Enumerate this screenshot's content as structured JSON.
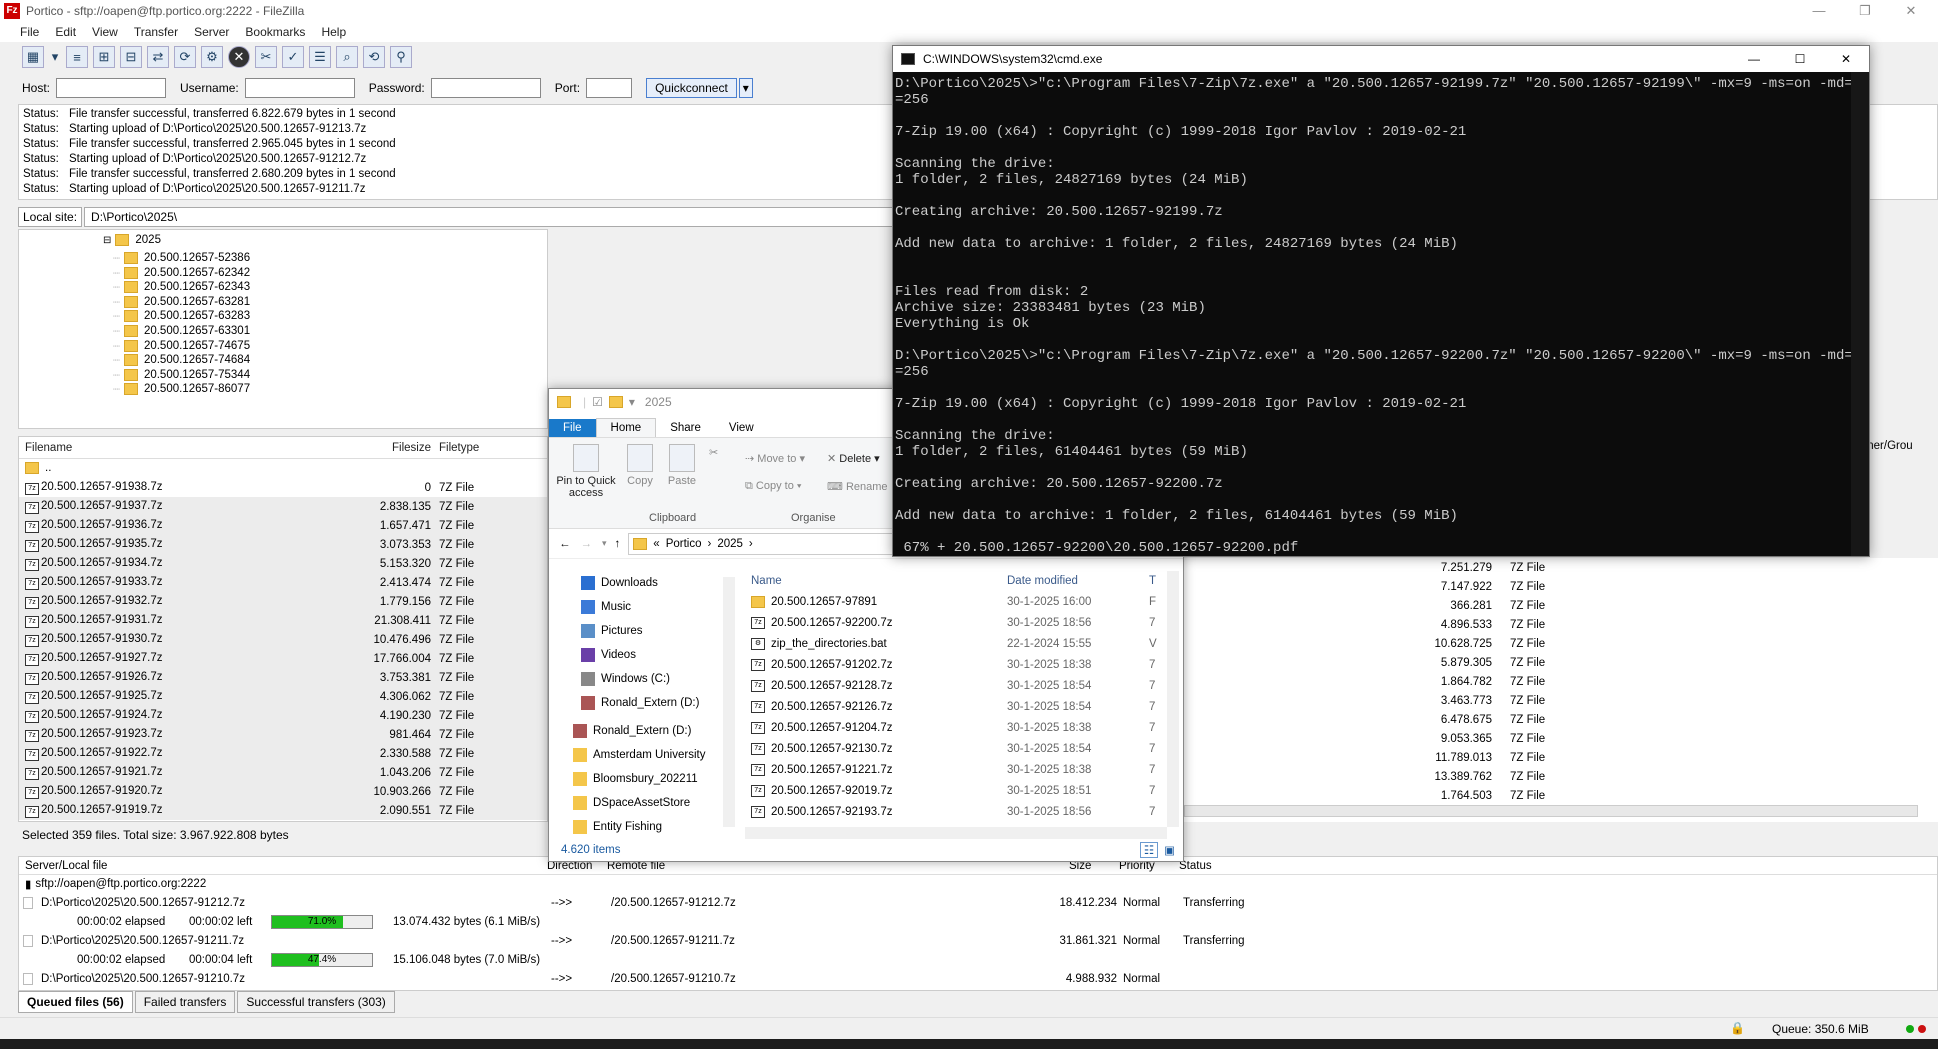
{
  "filezilla": {
    "title": "Portico - sftp://oapen@ftp.portico.org:2222 - FileZilla",
    "menu": [
      "File",
      "Edit",
      "View",
      "Transfer",
      "Server",
      "Bookmarks",
      "Help"
    ],
    "quickconnect": {
      "host_label": "Host:",
      "username_label": "Username:",
      "password_label": "Password:",
      "port_label": "Port:",
      "button": "Quickconnect"
    },
    "log": [
      {
        "label": "Status:",
        "text": "File transfer successful, transferred 6.822.679 bytes in 1 second"
      },
      {
        "label": "Status:",
        "text": "Starting upload of D:\\Portico\\2025\\20.500.12657-91213.7z"
      },
      {
        "label": "Status:",
        "text": "File transfer successful, transferred 2.965.045 bytes in 1 second"
      },
      {
        "label": "Status:",
        "text": "Starting upload of D:\\Portico\\2025\\20.500.12657-91212.7z"
      },
      {
        "label": "Status:",
        "text": "File transfer successful, transferred 2.680.209 bytes in 1 second"
      },
      {
        "label": "Status:",
        "text": "Starting upload of D:\\Portico\\2025\\20.500.12657-91211.7z"
      }
    ],
    "local_site_label": "Local site:",
    "local_site_path": "D:\\Portico\\2025\\",
    "tree_root": "2025",
    "tree": [
      "20.500.12657-52386",
      "20.500.12657-62342",
      "20.500.12657-62343",
      "20.500.12657-63281",
      "20.500.12657-63283",
      "20.500.12657-63301",
      "20.500.12657-74675",
      "20.500.12657-74684",
      "20.500.12657-75344",
      "20.500.12657-86077"
    ],
    "columns": {
      "filename": "Filename",
      "filesize": "Filesize",
      "filetype": "Filetype",
      "owner": "Owner/Grou"
    },
    "parent": "..",
    "files": [
      {
        "name": "20.500.12657-91938.7z",
        "size": "0",
        "type": "7Z File"
      },
      {
        "name": "20.500.12657-91937.7z",
        "size": "2.838.135",
        "type": "7Z File"
      },
      {
        "name": "20.500.12657-91936.7z",
        "size": "1.657.471",
        "type": "7Z File"
      },
      {
        "name": "20.500.12657-91935.7z",
        "size": "3.073.353",
        "type": "7Z File"
      },
      {
        "name": "20.500.12657-91934.7z",
        "size": "5.153.320",
        "type": "7Z File"
      },
      {
        "name": "20.500.12657-91933.7z",
        "size": "2.413.474",
        "type": "7Z File"
      },
      {
        "name": "20.500.12657-91932.7z",
        "size": "1.779.156",
        "type": "7Z File"
      },
      {
        "name": "20.500.12657-91931.7z",
        "size": "21.308.411",
        "type": "7Z File"
      },
      {
        "name": "20.500.12657-91930.7z",
        "size": "10.476.496",
        "type": "7Z File"
      },
      {
        "name": "20.500.12657-91927.7z",
        "size": "17.766.004",
        "type": "7Z File"
      },
      {
        "name": "20.500.12657-91926.7z",
        "size": "3.753.381",
        "type": "7Z File"
      },
      {
        "name": "20.500.12657-91925.7z",
        "size": "4.306.062",
        "type": "7Z File"
      },
      {
        "name": "20.500.12657-91924.7z",
        "size": "4.190.230",
        "type": "7Z File"
      },
      {
        "name": "20.500.12657-91923.7z",
        "size": "981.464",
        "type": "7Z File"
      },
      {
        "name": "20.500.12657-91922.7z",
        "size": "2.330.588",
        "type": "7Z File"
      },
      {
        "name": "20.500.12657-91921.7z",
        "size": "1.043.206",
        "type": "7Z File"
      },
      {
        "name": "20.500.12657-91920.7z",
        "size": "10.903.266",
        "type": "7Z File"
      },
      {
        "name": "20.500.12657-91919.7z",
        "size": "2.090.551",
        "type": "7Z File"
      }
    ],
    "remote_files": [
      {
        "size": "7.251.279",
        "type": "7Z File"
      },
      {
        "size": "7.147.922",
        "type": "7Z File"
      },
      {
        "size": "366.281",
        "type": "7Z File"
      },
      {
        "size": "4.896.533",
        "type": "7Z File"
      },
      {
        "size": "10.628.725",
        "type": "7Z File"
      },
      {
        "size": "5.879.305",
        "type": "7Z File"
      },
      {
        "size": "1.864.782",
        "type": "7Z File"
      },
      {
        "size": "3.463.773",
        "type": "7Z File"
      },
      {
        "size": "6.478.675",
        "type": "7Z File"
      },
      {
        "size": "9.053.365",
        "type": "7Z File"
      },
      {
        "size": "11.789.013",
        "type": "7Z File"
      },
      {
        "size": "13.389.762",
        "type": "7Z File"
      },
      {
        "size": "1.764.503",
        "type": "7Z File"
      }
    ],
    "selection_info": "Selected 359 files. Total size: 3.967.922.808 bytes",
    "queue_cols": {
      "server": "Server/Local file",
      "direction": "Direction",
      "remote": "Remote file",
      "size": "Size",
      "priority": "Priority",
      "status": "Status"
    },
    "queue_server": "sftp://oapen@ftp.portico.org:2222",
    "queue": [
      {
        "local": "D:\\Portico\\2025\\20.500.12657-91212.7z",
        "dir": "-->>",
        "remote": "/20.500.12657-91212.7z",
        "size": "18.412.234",
        "priority": "Normal",
        "status": "Transferring",
        "elapsed": "00:00:02 elapsed",
        "left": "00:00:02 left",
        "percent": 71.0,
        "percent_text": "71.0%",
        "bytes": "13.074.432 bytes (6.1 MiB/s)"
      },
      {
        "local": "D:\\Portico\\2025\\20.500.12657-91211.7z",
        "dir": "-->>",
        "remote": "/20.500.12657-91211.7z",
        "size": "31.861.321",
        "priority": "Normal",
        "status": "Transferring",
        "elapsed": "00:00:02 elapsed",
        "left": "00:00:04 left",
        "percent": 47.4,
        "percent_text": "47.4%",
        "bytes": "15.106.048 bytes (7.0 MiB/s)"
      },
      {
        "local": "D:\\Portico\\2025\\20.500.12657-91210.7z",
        "dir": "-->>",
        "remote": "/20.500.12657-91210.7z",
        "size": "4.988.932",
        "priority": "Normal",
        "status": ""
      }
    ],
    "tabs": [
      "Queued files (56)",
      "Failed transfers",
      "Successful transfers (303)"
    ],
    "queue_size": "Queue: 350.6 MiB"
  },
  "explorer": {
    "title": "2025",
    "tabs": [
      "File",
      "Home",
      "Share",
      "View"
    ],
    "ribbon": {
      "pin": "Pin to Quick access",
      "copy": "Copy",
      "paste": "Paste",
      "move_to": "Move to",
      "copy_to": "Copy to",
      "delete": "Delete",
      "rename": "Rename",
      "clipboard": "Clipboard",
      "organise": "Organise"
    },
    "breadcrumb": [
      "«",
      "Portico",
      "›",
      "2025",
      "›"
    ],
    "nav": [
      "Downloads",
      "Music",
      "Pictures",
      "Videos",
      "Windows (C:)",
      "Ronald_Extern (D:)",
      "Ronald_Extern (D:)",
      "Amsterdam University",
      "Bloomsbury_202211",
      "DSpaceAssetStore",
      "Entity Fishing"
    ],
    "columns": {
      "name": "Name",
      "date": "Date modified",
      "type": "T"
    },
    "items": [
      {
        "name": "20.500.12657-97891",
        "date": "30-1-2025 16:00",
        "t": "F",
        "kind": "folder"
      },
      {
        "name": "20.500.12657-92200.7z",
        "date": "30-1-2025 18:56",
        "t": "7",
        "kind": "7z"
      },
      {
        "name": "zip_the_directories.bat",
        "date": "22-1-2024 15:55",
        "t": "V",
        "kind": "bat"
      },
      {
        "name": "20.500.12657-91202.7z",
        "date": "30-1-2025 18:38",
        "t": "7",
        "kind": "7z"
      },
      {
        "name": "20.500.12657-92128.7z",
        "date": "30-1-2025 18:54",
        "t": "7",
        "kind": "7z"
      },
      {
        "name": "20.500.12657-92126.7z",
        "date": "30-1-2025 18:54",
        "t": "7",
        "kind": "7z"
      },
      {
        "name": "20.500.12657-91204.7z",
        "date": "30-1-2025 18:38",
        "t": "7",
        "kind": "7z"
      },
      {
        "name": "20.500.12657-92130.7z",
        "date": "30-1-2025 18:54",
        "t": "7",
        "kind": "7z"
      },
      {
        "name": "20.500.12657-91221.7z",
        "date": "30-1-2025 18:38",
        "t": "7",
        "kind": "7z"
      },
      {
        "name": "20.500.12657-92019.7z",
        "date": "30-1-2025 18:51",
        "t": "7",
        "kind": "7z"
      },
      {
        "name": "20.500.12657-92193.7z",
        "date": "30-1-2025 18:56",
        "t": "7",
        "kind": "7z"
      }
    ],
    "count": "4.620 items"
  },
  "cmd": {
    "title": "C:\\WINDOWS\\system32\\cmd.exe",
    "lines": [
      "D:\\Portico\\2025\\>\"c:\\Program Files\\7-Zip\\7z.exe\" a \"20.500.12657-92199.7z\" \"20.500.12657-92199\\\" -mx=9 -ms=on -md=26 -mfb",
      "=256",
      "",
      "7-Zip 19.00 (x64) : Copyright (c) 1999-2018 Igor Pavlov : 2019-02-21",
      "",
      "Scanning the drive:",
      "1 folder, 2 files, 24827169 bytes (24 MiB)",
      "",
      "Creating archive: 20.500.12657-92199.7z",
      "",
      "Add new data to archive: 1 folder, 2 files, 24827169 bytes (24 MiB)",
      "",
      "",
      "Files read from disk: 2",
      "Archive size: 23383481 bytes (23 MiB)",
      "Everything is Ok",
      "",
      "D:\\Portico\\2025\\>\"c:\\Program Files\\7-Zip\\7z.exe\" a \"20.500.12657-92200.7z\" \"20.500.12657-92200\\\" -mx=9 -ms=on -md=26 -mfb",
      "=256",
      "",
      "7-Zip 19.00 (x64) : Copyright (c) 1999-2018 Igor Pavlov : 2019-02-21",
      "",
      "Scanning the drive:",
      "1 folder, 2 files, 61404461 bytes (59 MiB)",
      "",
      "Creating archive: 20.500.12657-92200.7z",
      "",
      "Add new data to archive: 1 folder, 2 files, 61404461 bytes (59 MiB)",
      "",
      " 67% + 20.500.12657-92200\\20.500.12657-92200.pdf"
    ]
  }
}
